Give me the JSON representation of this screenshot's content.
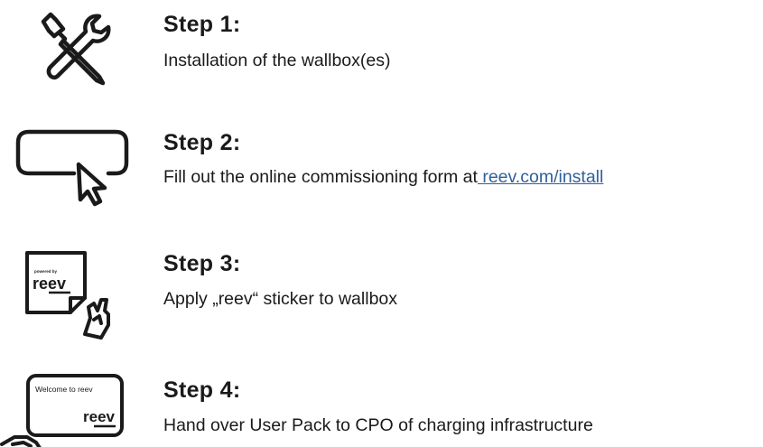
{
  "steps": [
    {
      "title": "Step 1:",
      "description": "Installation of the wallbox(es)",
      "icon": "tools-icon"
    },
    {
      "title": "Step 2:",
      "description": "Fill out the online commissioning form at",
      "link_text": " reev.com/install",
      "icon": "cursor-field-icon"
    },
    {
      "title": "Step 3:",
      "description": "Apply „reev“ sticker to wallbox",
      "icon": "sticker-icon",
      "icon_text": {
        "small": "powered by",
        "brand": "reev"
      }
    },
    {
      "title": "Step 4:",
      "description": "Hand over User Pack to CPO of charging infrastructure",
      "icon": "user-pack-icon",
      "icon_text": {
        "welcome": "Welcome to reev",
        "brand": "reev"
      }
    }
  ],
  "colors": {
    "text": "#1a1a1a",
    "link": "#2f5f9e"
  }
}
